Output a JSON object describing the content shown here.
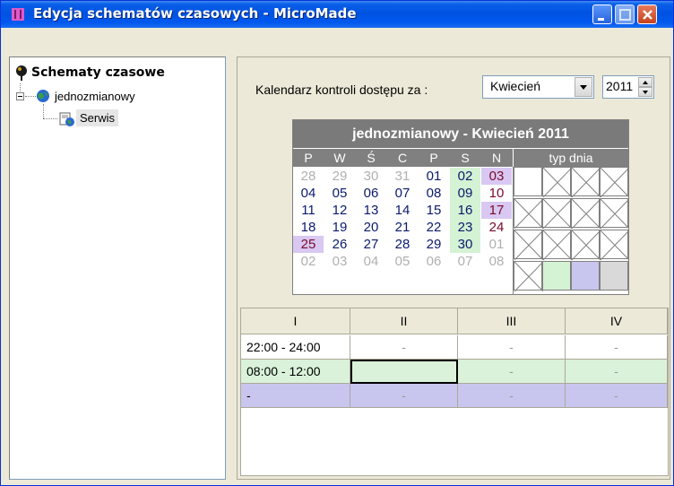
{
  "window": {
    "title": "Edycja schematów czasowych - MicroMade",
    "app_icon": "micromade-app-icon",
    "controls": [
      "minimize-icon",
      "maximize-icon",
      "close-icon"
    ]
  },
  "tree": {
    "root": {
      "label": "Schematy czasowe",
      "icon": "pin-icon"
    },
    "child": {
      "label": "jednozmianowy",
      "icon": "globe-icon",
      "expanded": true
    },
    "leaf": {
      "label": "Serwis",
      "icon": "document-icon",
      "selected": true
    }
  },
  "controls": {
    "calendar_label": "Kalendarz kontroli dostępu za :",
    "month_value": "Kwiecień",
    "year_value": "2011"
  },
  "calendar": {
    "header": "jednozmianowy - Kwiecień 2011",
    "weekdays": [
      "P",
      "W",
      "Ś",
      "C",
      "P",
      "S",
      "N"
    ],
    "typ_dnia_label": "typ dnia",
    "weeks": [
      [
        {
          "d": "28",
          "t": "other"
        },
        {
          "d": "29",
          "t": "other"
        },
        {
          "d": "30",
          "t": "other"
        },
        {
          "d": "31",
          "t": "other"
        },
        {
          "d": "01",
          "t": ""
        },
        {
          "d": "02",
          "t": "green"
        },
        {
          "d": "03",
          "t": "purple"
        }
      ],
      [
        {
          "d": "04",
          "t": ""
        },
        {
          "d": "05",
          "t": ""
        },
        {
          "d": "06",
          "t": ""
        },
        {
          "d": "07",
          "t": ""
        },
        {
          "d": "08",
          "t": ""
        },
        {
          "d": "09",
          "t": "green"
        },
        {
          "d": "10",
          "t": "sun"
        }
      ],
      [
        {
          "d": "11",
          "t": ""
        },
        {
          "d": "12",
          "t": ""
        },
        {
          "d": "13",
          "t": ""
        },
        {
          "d": "14",
          "t": ""
        },
        {
          "d": "15",
          "t": ""
        },
        {
          "d": "16",
          "t": "green"
        },
        {
          "d": "17",
          "t": "purple"
        }
      ],
      [
        {
          "d": "18",
          "t": ""
        },
        {
          "d": "19",
          "t": ""
        },
        {
          "d": "20",
          "t": ""
        },
        {
          "d": "21",
          "t": ""
        },
        {
          "d": "22",
          "t": ""
        },
        {
          "d": "23",
          "t": "green"
        },
        {
          "d": "24",
          "t": "sun"
        }
      ],
      [
        {
          "d": "25",
          "t": "purple"
        },
        {
          "d": "26",
          "t": ""
        },
        {
          "d": "27",
          "t": ""
        },
        {
          "d": "28",
          "t": ""
        },
        {
          "d": "29",
          "t": ""
        },
        {
          "d": "30",
          "t": "green"
        },
        {
          "d": "01",
          "t": "other"
        }
      ],
      [
        {
          "d": "02",
          "t": "other"
        },
        {
          "d": "03",
          "t": "other"
        },
        {
          "d": "04",
          "t": "other"
        },
        {
          "d": "05",
          "t": "other"
        },
        {
          "d": "06",
          "t": "other"
        },
        {
          "d": "07",
          "t": "other"
        },
        {
          "d": "08",
          "t": "other"
        }
      ]
    ],
    "day_type_swatches": [
      [
        "white",
        "x",
        "x",
        "x"
      ],
      [
        "x",
        "x",
        "x",
        "x"
      ],
      [
        "x",
        "x",
        "x",
        "x"
      ],
      [
        "x",
        "green",
        "purple",
        "gray"
      ]
    ],
    "colors": {
      "green": "#D4F2D4",
      "purple": "#C8C6EE",
      "gray": "#D9D9D9",
      "header": "#7A7A7A"
    }
  },
  "schedule": {
    "columns": [
      "I",
      "II",
      "III",
      "IV"
    ],
    "rows": [
      {
        "cells": [
          "22:00 - 24:00",
          "-",
          "-",
          "-"
        ],
        "style": "white"
      },
      {
        "cells": [
          "08:00 - 12:00",
          "",
          "-",
          "-"
        ],
        "style": "green"
      },
      {
        "cells": [
          "-",
          "-",
          "-",
          "-"
        ],
        "style": "purple"
      }
    ]
  }
}
